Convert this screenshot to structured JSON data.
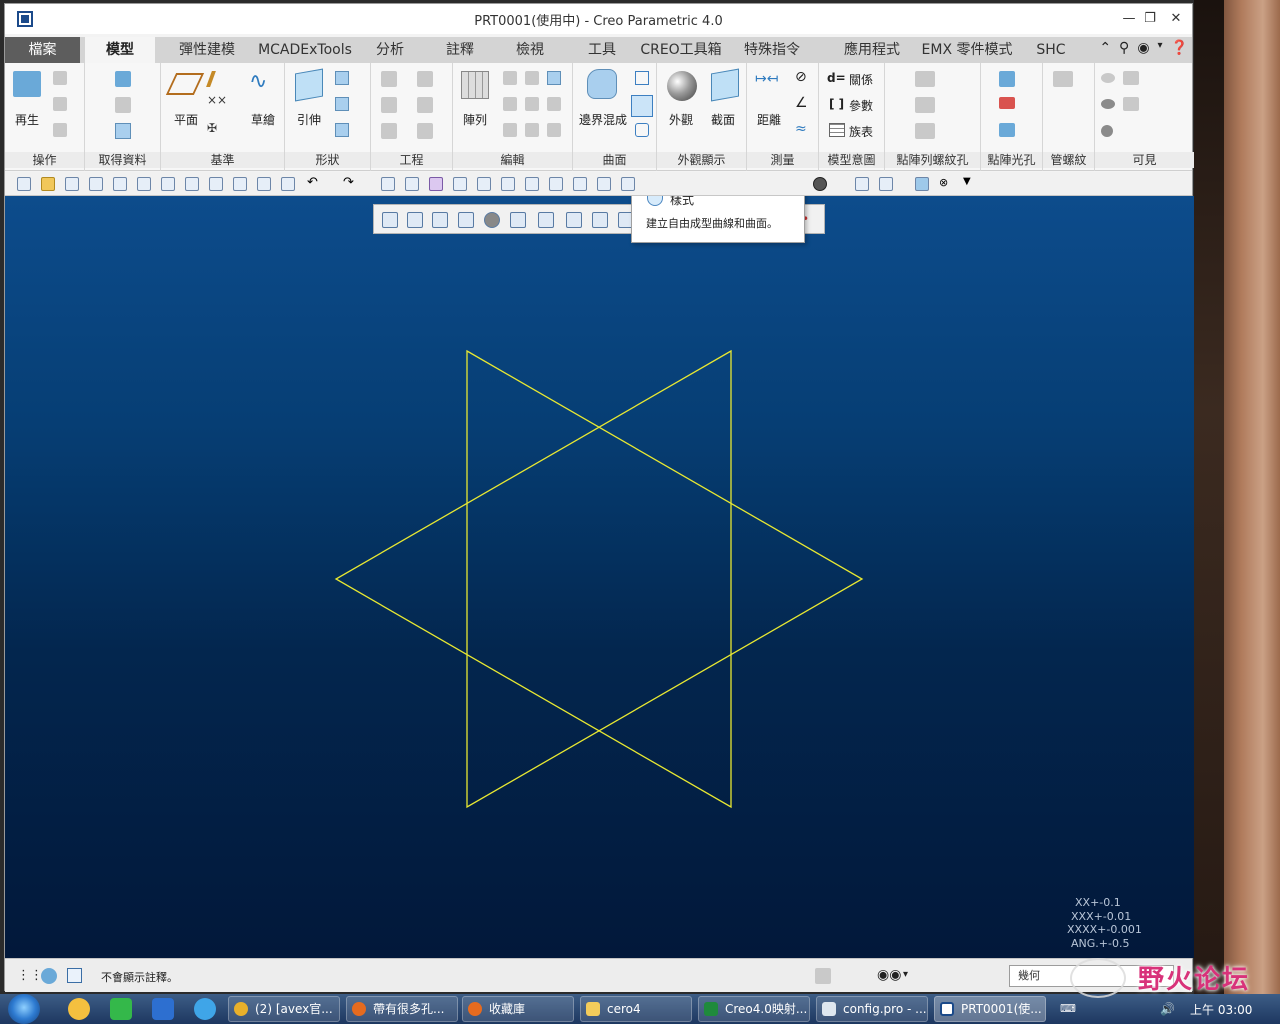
{
  "window": {
    "title": "PRT0001(使用中) - Creo Parametric 4.0"
  },
  "tabs": [
    {
      "label": "檔案"
    },
    {
      "label": "模型"
    },
    {
      "label": "彈性建模"
    },
    {
      "label": "MCADExTools"
    },
    {
      "label": "分析"
    },
    {
      "label": "註釋"
    },
    {
      "label": "檢視"
    },
    {
      "label": "工具"
    },
    {
      "label": "CREO工具箱"
    },
    {
      "label": "特殊指令"
    },
    {
      "label": "應用程式"
    },
    {
      "label": "EMX 零件模式"
    },
    {
      "label": "SHC"
    }
  ],
  "ribbon": {
    "groups": [
      {
        "label": "操作"
      },
      {
        "label": "取得資料"
      },
      {
        "label": "基準"
      },
      {
        "label": "形狀"
      },
      {
        "label": "工程"
      },
      {
        "label": "編輯"
      },
      {
        "label": "曲面"
      },
      {
        "label": "外觀顯示"
      },
      {
        "label": "測量"
      },
      {
        "label": "模型意圖"
      },
      {
        "label": "點陣列螺紋孔"
      },
      {
        "label": "點陣光孔"
      },
      {
        "label": "管螺紋"
      },
      {
        "label": "可見"
      }
    ],
    "buttons": {
      "regenerate": "再生",
      "plane": "平面",
      "sketch": "草繪",
      "extrude": "引伸",
      "pattern": "陣列",
      "boundary_blend": "邊界混成",
      "appearance": "外觀",
      "section": "截面",
      "distance": "距離",
      "relations": "關係",
      "parameters": "參數",
      "family_table": "族表",
      "dim_prefix": "d="
    }
  },
  "tooltip": {
    "title": "樣式",
    "description": "建立自由成型曲線和曲面。"
  },
  "tolerance": [
    "XX+-0.1",
    "XXX+-0.01",
    "XXXX+-0.001",
    "ANG.+-0.5"
  ],
  "status": {
    "message": "不會顯示註釋。",
    "filter": "幾何"
  },
  "taskbar": {
    "tasks": [
      {
        "label": "(2) [avex官..."
      },
      {
        "label": "帶有很多孔..."
      },
      {
        "label": "收藏庫"
      },
      {
        "label": "cero4"
      },
      {
        "label": "Creo4.0映射..."
      },
      {
        "label": "config.pro - ..."
      },
      {
        "label": "PRT0001(使..."
      }
    ],
    "clock": "上午 03:00"
  },
  "watermark": "野火论坛",
  "colors": {
    "sketch_line": "#e8e832",
    "viewport_top": "#0d4c8c",
    "viewport_bottom": "#02183a"
  }
}
